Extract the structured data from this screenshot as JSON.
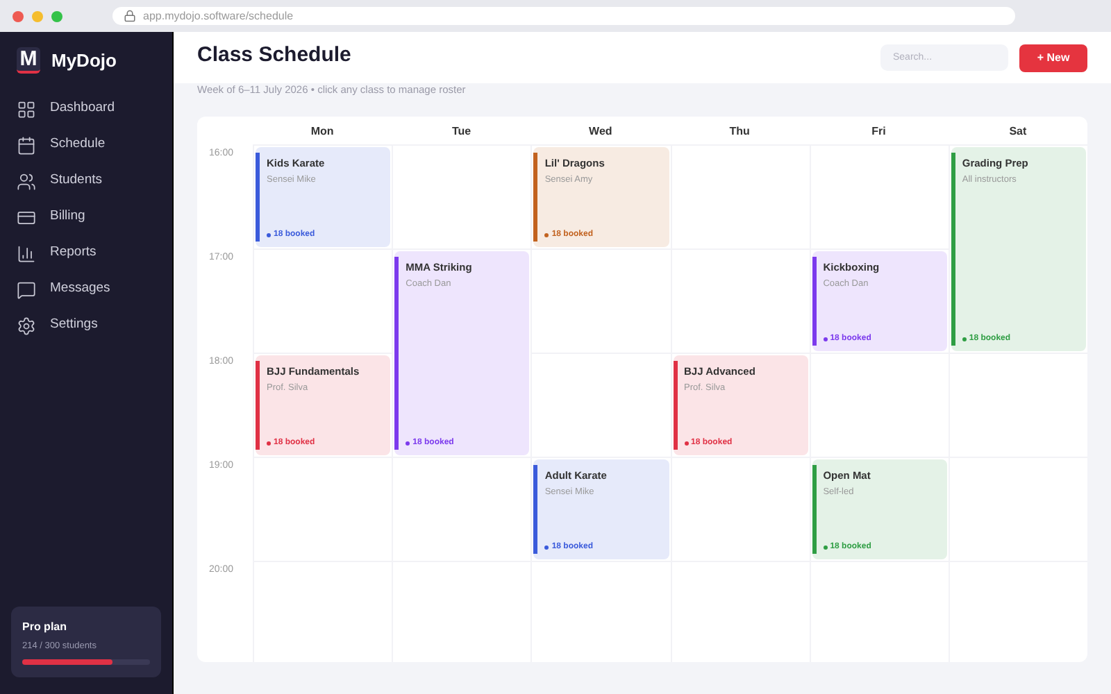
{
  "browser": {
    "url": "app.mydojo.software/schedule"
  },
  "sidebar": {
    "logo_letter": "M",
    "brand": "MyDojo",
    "items": [
      {
        "label": "Dashboard"
      },
      {
        "label": "Schedule"
      },
      {
        "label": "Students"
      },
      {
        "label": "Billing"
      },
      {
        "label": "Reports"
      },
      {
        "label": "Messages"
      },
      {
        "label": "Settings"
      }
    ],
    "plan": {
      "title": "Pro plan",
      "usage": "214 / 300 students",
      "level": 0.71
    }
  },
  "header": {
    "title": "Class Schedule",
    "search": {
      "placeholder": "Search..."
    },
    "new_button": "+ New"
  },
  "subtitle": "Week of 6–11 July 2026 • click any class to manage roster",
  "calendar": {
    "times": [
      "16:00",
      "17:00",
      "18:00",
      "19:00",
      "20:00"
    ],
    "days": [
      {
        "label": "Mon",
        "entries": [
          {
            "kind": "class",
            "title": "Kids Karate",
            "instructor": "Sensei Mike",
            "booked": "18 booked",
            "color": "#3b5bdb"
          },
          {
            "kind": "empty"
          },
          {
            "kind": "class",
            "title": "BJJ Fundamentals",
            "instructor": "Prof. Silva",
            "booked": "18 booked",
            "color": "#e03145"
          },
          {
            "kind": "empty"
          },
          {
            "kind": "empty"
          }
        ]
      },
      {
        "label": "Tue",
        "entries": [
          {
            "kind": "empty"
          },
          {
            "kind": "long-class",
            "title": "MMA Striking",
            "instructor": "Coach Dan",
            "booked": "18 booked",
            "color": "#7c3aed"
          },
          {
            "kind": "empty"
          },
          {
            "kind": "empty"
          }
        ]
      },
      {
        "label": "Wed",
        "entries": [
          {
            "kind": "class",
            "title": "Lil' Dragons",
            "instructor": "Sensei Amy",
            "booked": "18 booked",
            "color": "#c2621f"
          },
          {
            "kind": "empty"
          },
          {
            "kind": "empty"
          },
          {
            "kind": "class",
            "title": "Adult Karate",
            "instructor": "Sensei Mike",
            "booked": "18 booked",
            "color": "#3b5bdb"
          },
          {
            "kind": "empty"
          }
        ]
      },
      {
        "label": "Thu",
        "entries": [
          {
            "kind": "empty"
          },
          {
            "kind": "empty"
          },
          {
            "kind": "class",
            "title": "BJJ Advanced",
            "instructor": "Prof. Silva",
            "booked": "18 booked",
            "color": "#e03145"
          },
          {
            "kind": "empty"
          },
          {
            "kind": "empty"
          }
        ]
      },
      {
        "label": "Fri",
        "entries": [
          {
            "kind": "empty"
          },
          {
            "kind": "class",
            "title": "Kickboxing",
            "instructor": "Coach Dan",
            "booked": "18 booked",
            "color": "#7c3aed"
          },
          {
            "kind": "empty"
          },
          {
            "kind": "class",
            "title": "Open Mat",
            "instructor": "Self-led",
            "booked": "18 booked",
            "color": "#2f9e44"
          },
          {
            "kind": "empty"
          }
        ]
      },
      {
        "label": "Sat",
        "entries": [
          {
            "kind": "long-class",
            "title": "Grading Prep",
            "instructor": "All instructors",
            "booked": "18 booked",
            "color": "#2f9e44"
          },
          {
            "kind": "empty"
          },
          {
            "kind": "empty"
          },
          {
            "kind": "empty"
          }
        ]
      }
    ]
  }
}
